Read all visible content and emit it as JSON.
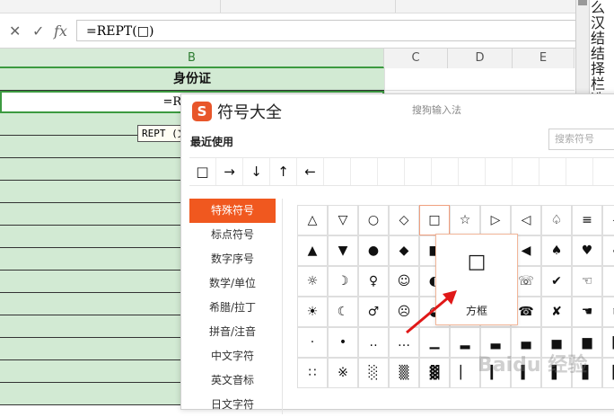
{
  "formula_bar": {
    "cancel_icon": "✕",
    "enter_icon": "✓",
    "fx_label": "fx",
    "value": "=REPT(□)"
  },
  "columns": [
    "B",
    "C",
    "D",
    "E"
  ],
  "sheet": {
    "header_cell": "身份证",
    "edit_cell": "=REPT(□",
    "tooltip": "REPT (文"
  },
  "right_panel": {
    "text_lines": [
      "么 汉",
      "结",
      "结 择",
      "栏",
      "选"
    ]
  },
  "dialog": {
    "logo": "S",
    "title": "符号大全",
    "subtitle": "搜狗输入法",
    "recent_label": "最近使用",
    "search_placeholder": "搜索符号",
    "recent_symbols": [
      "□",
      "→",
      "↓",
      "↑",
      "←",
      "",
      "",
      "",
      "",
      "",
      "",
      "",
      "",
      "",
      "",
      ""
    ],
    "categories": [
      "特殊符号",
      "标点符号",
      "数字序号",
      "数学/单位",
      "希腊/拉丁",
      "拼音/注音",
      "中文字符",
      "英文音标",
      "日文字符"
    ],
    "selected_category": 0,
    "grid_rows": [
      [
        "△",
        "▽",
        "○",
        "◇",
        "□",
        "☆",
        "▷",
        "◁",
        "♤",
        "≡",
        "◁"
      ],
      [
        "▲",
        "▼",
        "●",
        "◆",
        "■",
        "★",
        "▶",
        "◀",
        "♠",
        "♥",
        "♣"
      ],
      [
        "☼",
        "☽",
        "♀",
        "☺",
        "◐",
        "☻",
        "◑",
        "☏",
        "✔",
        "☜",
        "☝"
      ],
      [
        "☀",
        "☾",
        "♂",
        "☹",
        "◒",
        "☠",
        "◓",
        "☎",
        "✘",
        "☚",
        "☞"
      ],
      [
        "·",
        "•",
        "‥",
        "…",
        "▁",
        "▂",
        "▃",
        "▄",
        "▅",
        "▆",
        "▇"
      ],
      [
        "∷",
        "※",
        "░",
        "▒",
        "▓",
        "▏",
        "▎",
        "▍",
        "▌",
        "▋",
        "█"
      ]
    ],
    "popup": {
      "symbol": "□",
      "name": "方框"
    },
    "watermark": "Baidu 经验"
  }
}
